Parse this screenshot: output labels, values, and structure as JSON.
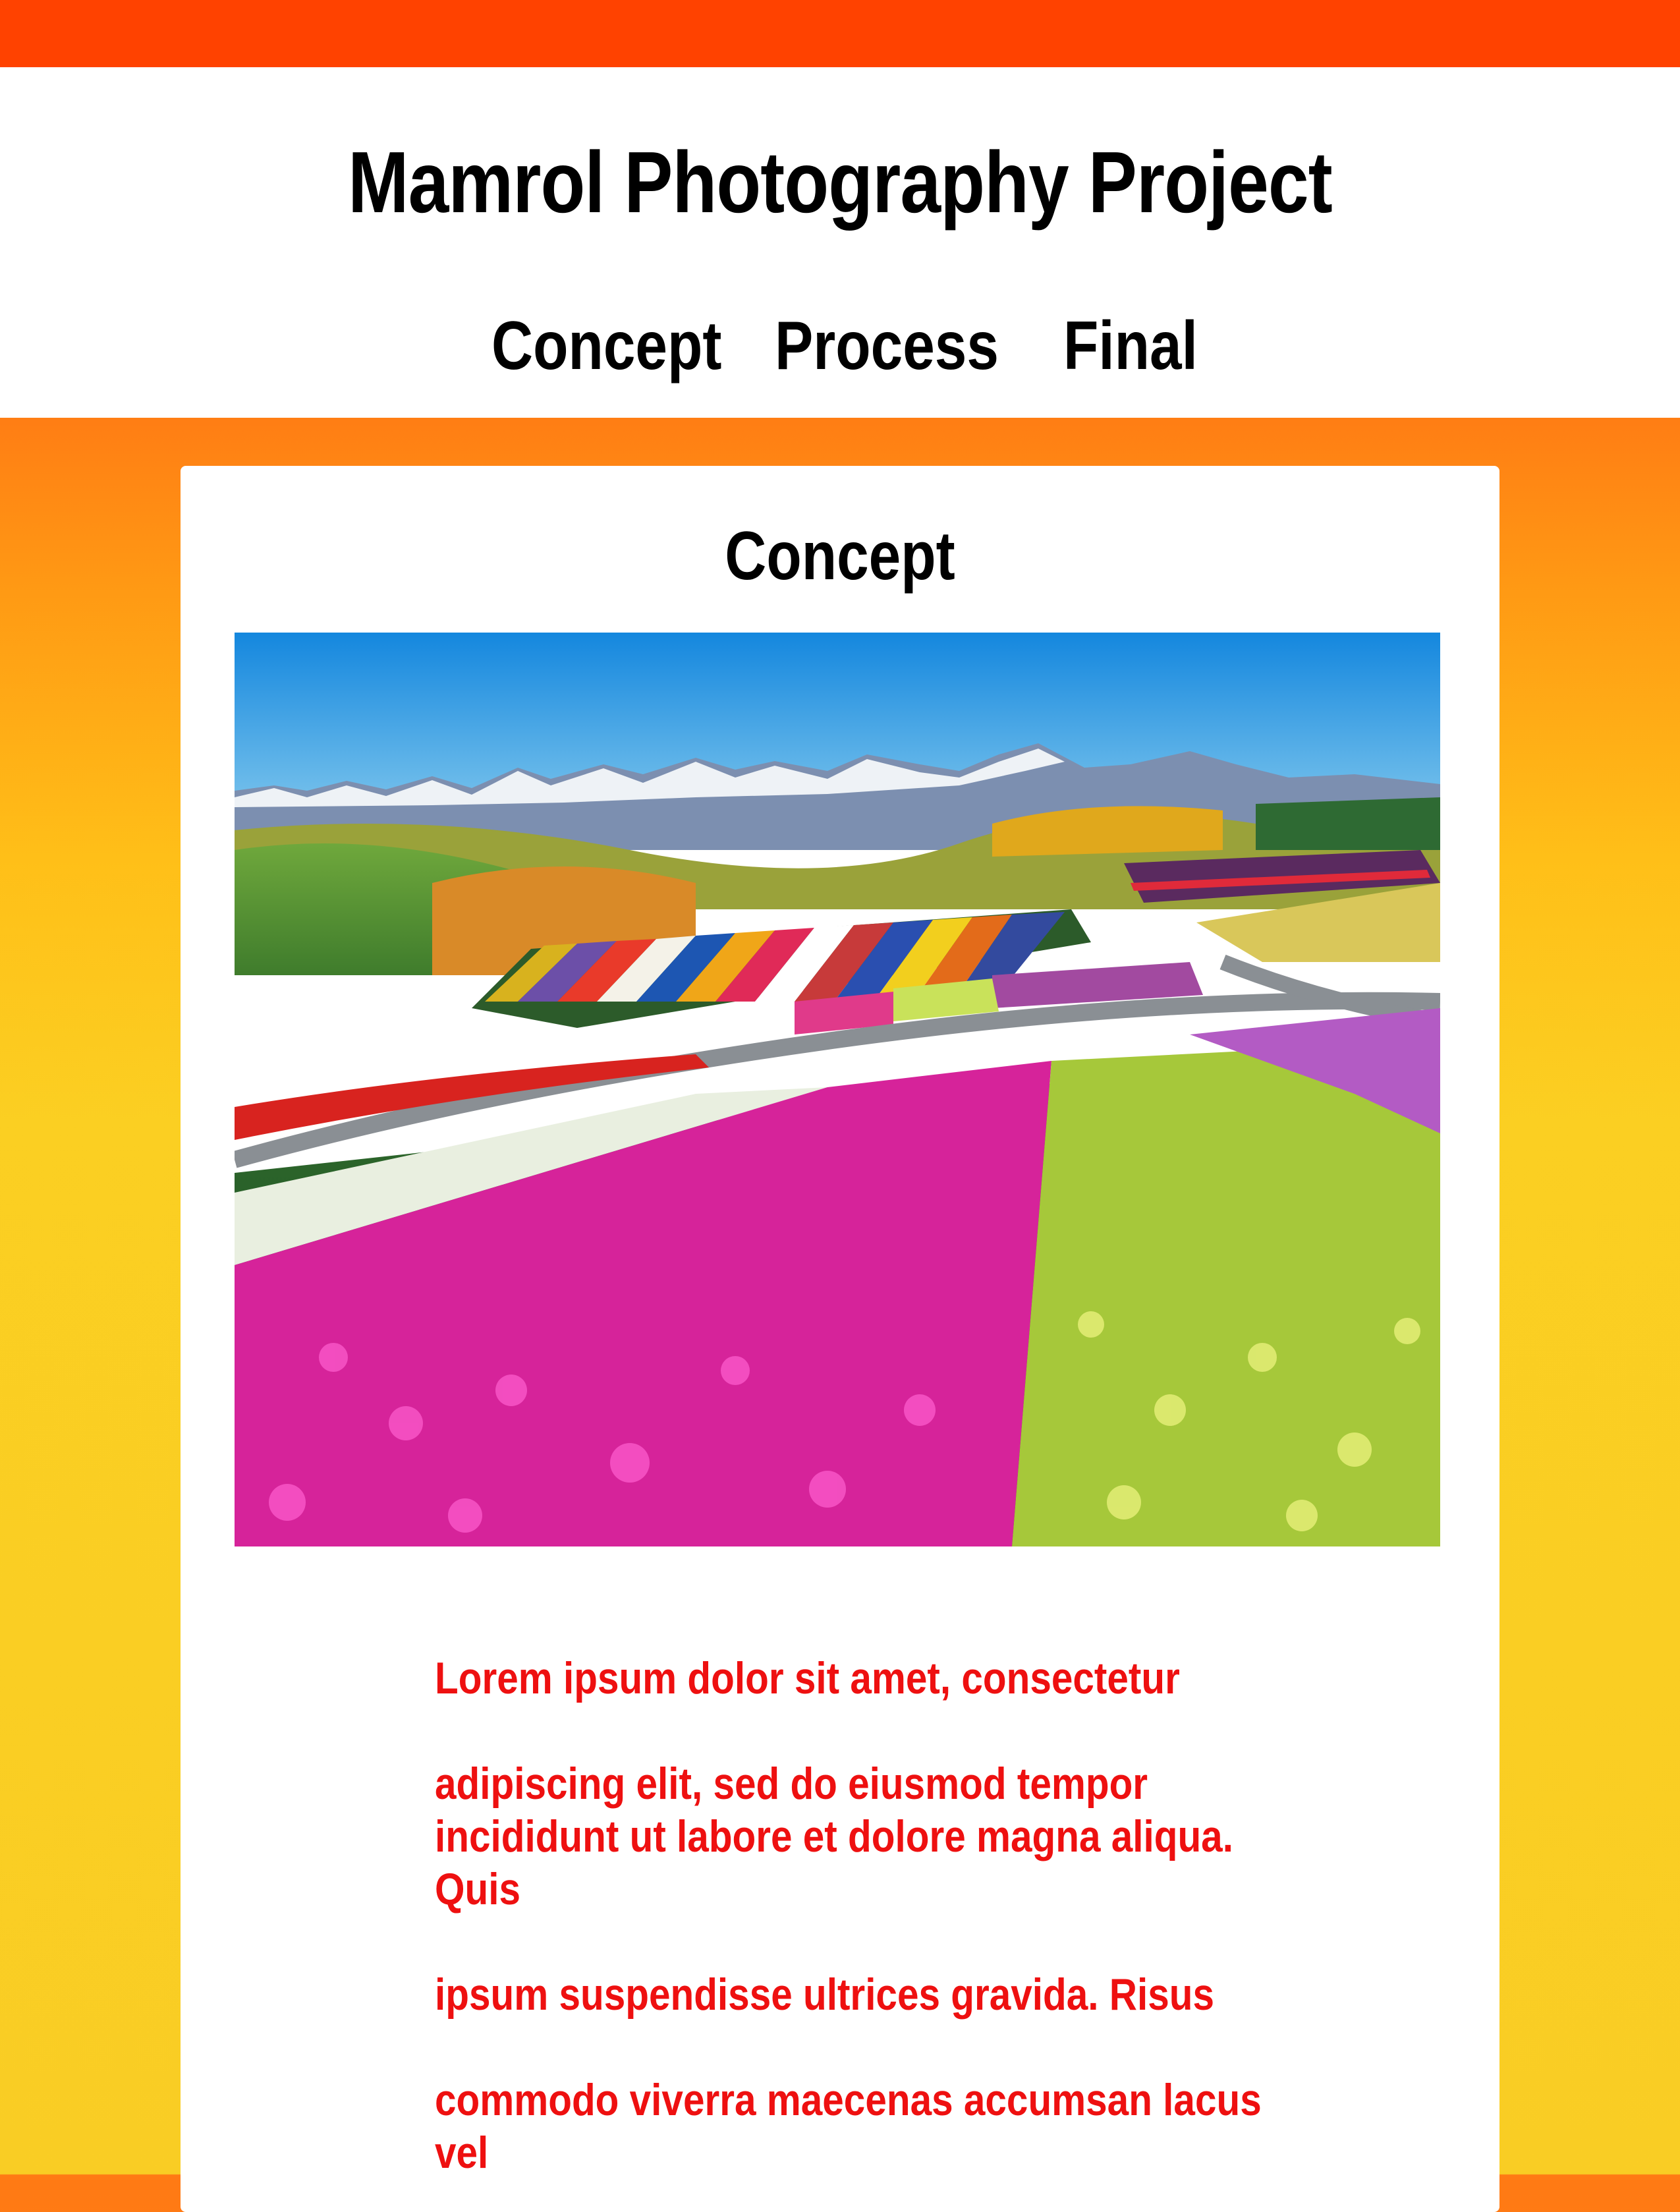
{
  "header": {
    "title": "Mamrol Photography Project",
    "nav": [
      {
        "label": "Concept"
      },
      {
        "label": "Process"
      },
      {
        "label": "Final"
      }
    ]
  },
  "main": {
    "section_title": "Concept",
    "photo_icon": "landscape-photo",
    "paragraph": "Lorem ipsum dolor sit amet, consectetur\n\nadipiscing elit, sed do eiusmod tempor\nincididunt ut labore et dolore magna aliqua. Quis\n\n ipsum suspendisse ultrices gravida. Risus\n\ncommodo viverra maecenas accumsan lacus vel"
  },
  "colors": {
    "top_bar": "#ff4200",
    "background_top": "#ff7a14",
    "background_bottom": "#f9cd24",
    "text_accent": "#ee1010"
  }
}
